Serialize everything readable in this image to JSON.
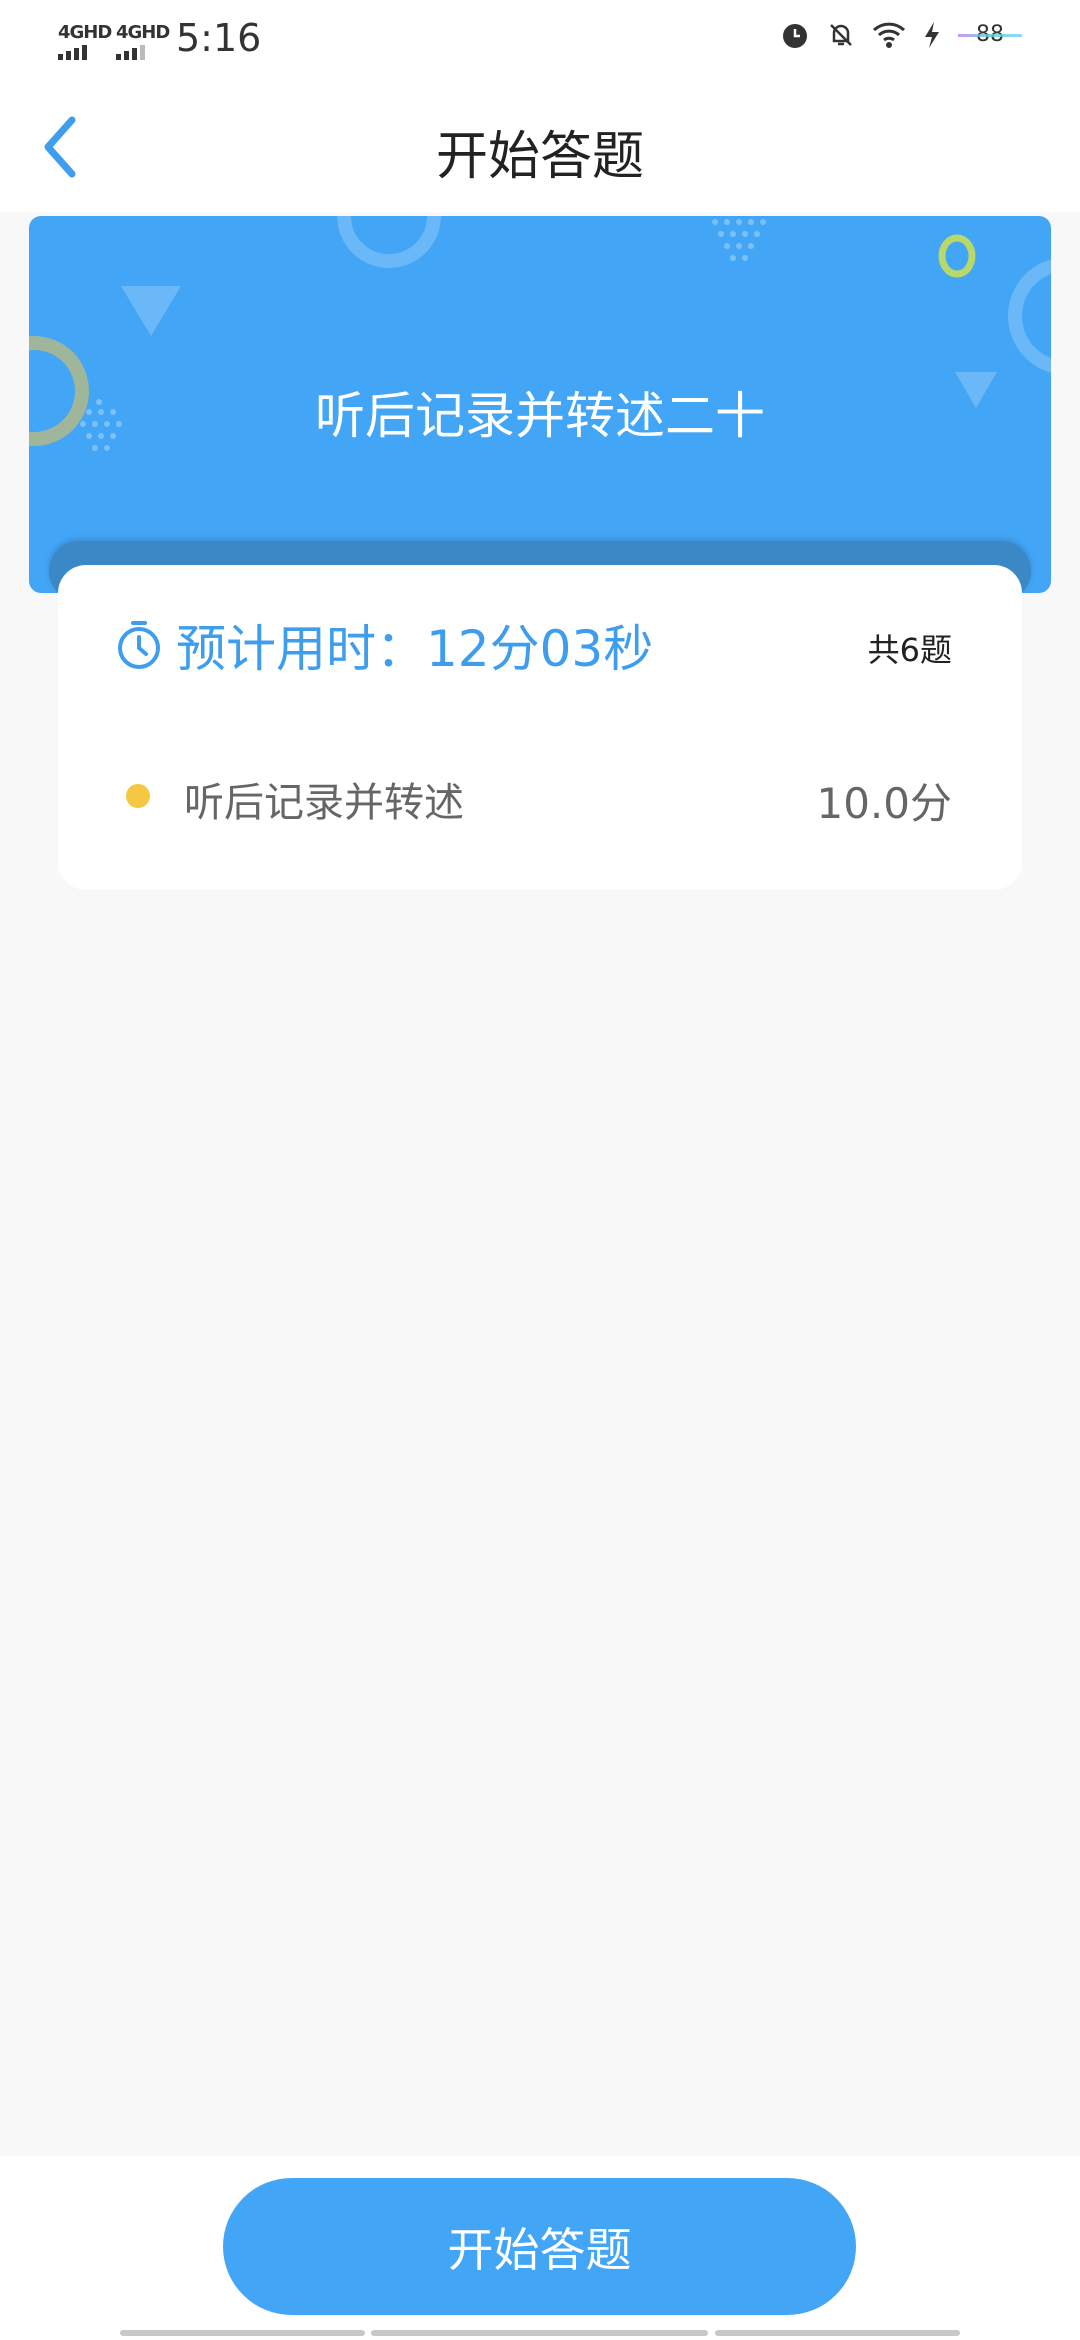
{
  "status_bar": {
    "network_1": "4GHD",
    "network_2": "4GHD",
    "time": "5:16",
    "battery": "88",
    "icons": [
      "alarm-icon",
      "bell-off-icon",
      "wifi-icon",
      "charging-icon",
      "battery-icon"
    ]
  },
  "nav": {
    "title": "开始答题",
    "back_icon": "chevron-left-icon"
  },
  "banner": {
    "title": "听后记录并转述二十"
  },
  "card": {
    "estimated_time": "预计用时：12分03秒",
    "total": "共6题",
    "section": {
      "label": "听后记录并转述",
      "score": "10.0分",
      "dot_color": "#f5c842"
    }
  },
  "footer": {
    "start_label": "开始答题"
  },
  "colors": {
    "accent": "#42a5f5",
    "accent_text": "#3f9ded",
    "background": "#f8f8f8"
  }
}
